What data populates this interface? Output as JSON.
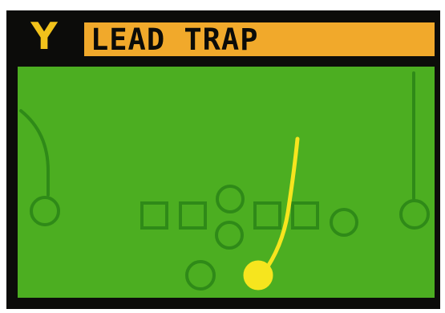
{
  "play": {
    "button": "Y",
    "name": "LEAD TRAP"
  },
  "colors": {
    "frame": "#0c0c0a",
    "button_letter": "#f2c21b",
    "title_bar": "#f1a92b",
    "field": "#4cae21",
    "player_outline": "#2f8a18",
    "ball_carrier": "#f6e51e",
    "ball_carrier_route": "#f6e51e"
  }
}
